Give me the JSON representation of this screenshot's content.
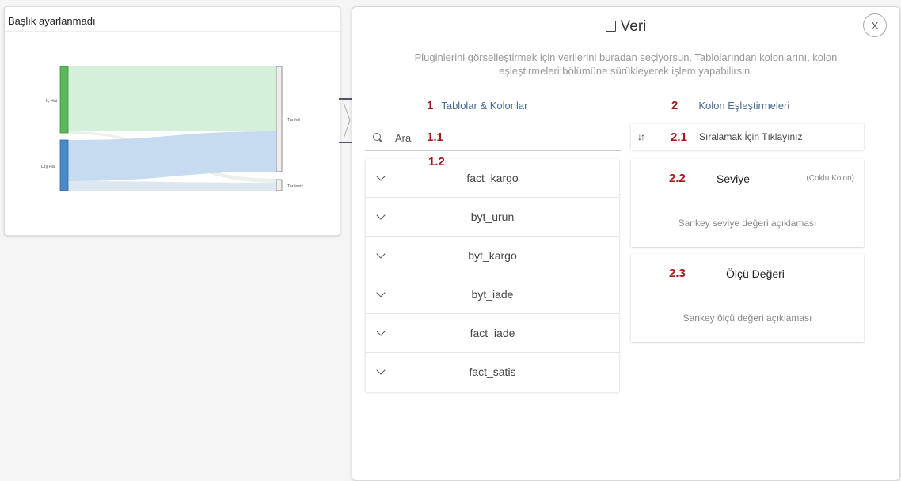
{
  "chart": {
    "title": "Başlık ayarlanmadı",
    "nodes": {
      "ic_hat": "İç Hat",
      "dis_hat": "Dış Hat",
      "tarifeli": "Tarifeli",
      "tarifesiz": "Tarifesiz"
    },
    "colors": {
      "ic_hat": "#5cb85c",
      "dis_hat": "#4a89c8",
      "flow_green": "#d4efda",
      "flow_blue": "#c6dbef"
    }
  },
  "panel": {
    "title": "Veri",
    "close_label": "X",
    "description_line1": "Pluginlerini görselleştirmek için verilerini buradan seçiyorsun. Tablolarından kolonlarını, kolon",
    "description_line2": "eşleştirmeleri bölümüne sürükleyerek işlem yapabilirsin.",
    "tables_section": {
      "number": "1",
      "label": "Tablolar & Kolonlar"
    },
    "mappings_section": {
      "number": "2",
      "label": "Kolon Eşleştirmeleri"
    },
    "search": {
      "label": "Ara",
      "number": "1.1"
    },
    "list_number": "1.2",
    "tables": [
      {
        "name": "fact_kargo"
      },
      {
        "name": "byt_urun"
      },
      {
        "name": "byt_kargo"
      },
      {
        "name": "byt_iade"
      },
      {
        "name": "fact_iade"
      },
      {
        "name": "fact_satis"
      }
    ],
    "sort": {
      "icon": "↓↑",
      "number": "2.1",
      "label": "Sıralamak İçin Tıklayınız"
    },
    "level": {
      "number": "2.2",
      "title": "Seviye",
      "hint": "(Çoklu Kolon)",
      "description": "Sankey seviye değeri açıklaması"
    },
    "measure": {
      "number": "2.3",
      "title": "Ölçü Değeri",
      "description": "Sankey ölçü değeri açıklaması"
    }
  }
}
